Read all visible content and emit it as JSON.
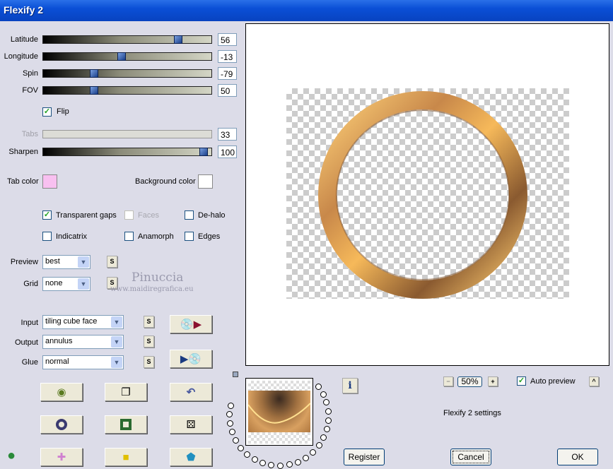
{
  "window": {
    "title": "Flexify 2"
  },
  "sliders": [
    {
      "label": "Latitude",
      "value": "56",
      "position": 0.81,
      "enabled": true
    },
    {
      "label": "Longitude",
      "value": "-13",
      "position": 0.46,
      "enabled": true
    },
    {
      "label": "Spin",
      "value": "-79",
      "position": 0.29,
      "enabled": true
    },
    {
      "label": "FOV",
      "value": "50",
      "position": 0.29,
      "enabled": true
    },
    {
      "label": "Tabs",
      "value": "33",
      "position": null,
      "enabled": false
    },
    {
      "label": "Sharpen",
      "value": "100",
      "position": 0.97,
      "enabled": true
    }
  ],
  "flip": {
    "label": "Flip",
    "checked": true
  },
  "colors": {
    "tab_label": "Tab color",
    "tab_color": "#f8c0f0",
    "bg_label": "Background color",
    "bg_color": "#ffffff"
  },
  "options": [
    {
      "label": "Transparent gaps",
      "checked": true,
      "enabled": true
    },
    {
      "label": "Faces",
      "checked": false,
      "enabled": false
    },
    {
      "label": "De-halo",
      "checked": false,
      "enabled": true
    },
    {
      "label": "Indicatrix",
      "checked": false,
      "enabled": true
    },
    {
      "label": "Anamorph",
      "checked": false,
      "enabled": true
    },
    {
      "label": "Edges",
      "checked": false,
      "enabled": true
    }
  ],
  "selects": {
    "preview": {
      "label": "Preview",
      "value": "best"
    },
    "grid": {
      "label": "Grid",
      "value": "none"
    },
    "input": {
      "label": "Input",
      "value": "tiling cube face"
    },
    "output": {
      "label": "Output",
      "value": "annulus"
    },
    "glue": {
      "label": "Glue",
      "value": "normal"
    }
  },
  "s_label": "S",
  "watermark": {
    "name": "Pinuccia",
    "url": "www.maidiregrafica.eu"
  },
  "zoom": {
    "value": "50%",
    "minus": "−",
    "plus": "+"
  },
  "auto_preview": {
    "label": "Auto preview",
    "checked": true
  },
  "status": "Flexify 2 settings",
  "buttons": {
    "register": "Register",
    "cancel": "Cancel",
    "ok": "OK",
    "info": "i",
    "collapse": "^"
  },
  "accent": "#0a4fd6"
}
